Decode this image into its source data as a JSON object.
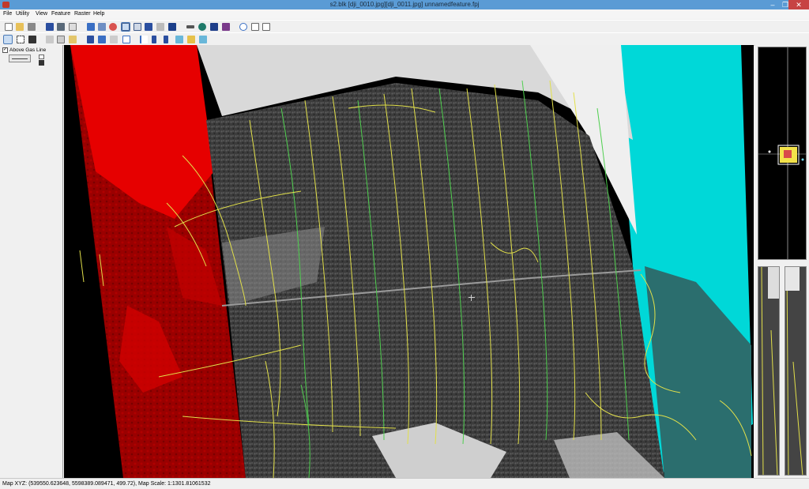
{
  "window": {
    "title": "s2.blk [dji_0010.jpg][dji_0011.jpg]  unnamedfeature.fpj",
    "minimize_icon": "minimize-icon",
    "maximize_icon": "maximize-icon",
    "close_icon": "close-icon"
  },
  "menu": {
    "items": [
      "File",
      "Utility",
      "View",
      "Feature",
      "Raster",
      "Help"
    ]
  },
  "toolbar1": {
    "icons": [
      "new-file-icon",
      "open-folder-icon",
      "save-icon",
      "open-block-icon",
      "edit-block-icon",
      "properties-icon",
      "zoom-extent-icon",
      "zoom-fit-icon",
      "zoom-reset-icon",
      "window-layout-icon",
      "single-view-icon",
      "dual-view-icon",
      "stereo-view-icon",
      "crosshair-icon",
      "measure-icon",
      "globe-icon",
      "info-icon",
      "refresh-icon",
      "copy-icon",
      "paste-icon"
    ]
  },
  "toolbar2": {
    "icons": [
      "select-pointer-icon",
      "select-rectangle-icon",
      "select-lasso-icon",
      "cut-icon",
      "copy-feature-icon",
      "paste-feature-icon",
      "axis-icon",
      "snap-icon",
      "vertex-icon",
      "rectangle-icon",
      "curve-icon",
      "spline-icon",
      "stream-icon",
      "cube-icon",
      "surface-icon",
      "building-icon"
    ]
  },
  "layer_panel": {
    "checkbox_label": "Above Gas Line",
    "checked": true,
    "line_style_icon": "line-style-swatch-icon",
    "layer_props_icon": "layer-properties-icon"
  },
  "views": {
    "main": "stereo-anaglyph-view",
    "overview": "overview-map",
    "detail_left": "left-detail-view",
    "detail_right": "right-detail-view"
  },
  "status": {
    "text": "Map XYZ: (539550.623648, 5598389.089471, 499.72), Map Scale: 1:1301.81061532"
  },
  "colors": {
    "titlebar": "#5a9bd5",
    "anaglyph_red": "#d40000",
    "anaglyph_cyan": "#00e5e5",
    "feature_yellow": "#e2e04a",
    "feature_green": "#4fcf4f"
  }
}
